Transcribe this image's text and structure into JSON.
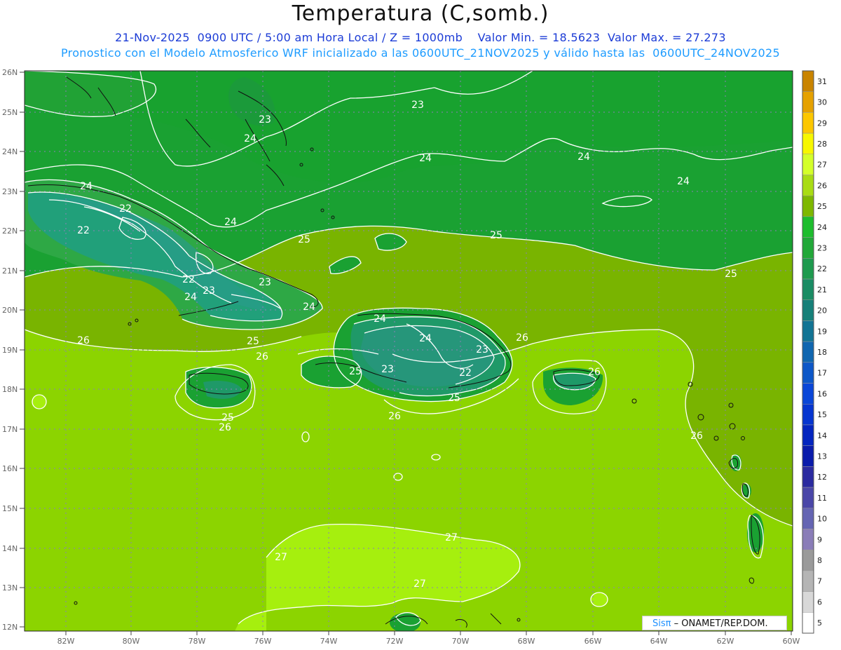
{
  "header": {
    "title": "Temperatura (C,somb.)",
    "line1": "21-Nov-2025  0900 UTC / 5:00 am Hora Local / Z = 1000mb    Valor Min. = 18.5623  Valor Max. = 27.273",
    "line2": "Pronostico con el Modelo Atmosferico WRF inicializado a las 0600UTC_21NOV2025 y válido hasta las  0600UTC_24NOV2025"
  },
  "map": {
    "lat_labels": [
      "26N",
      "25N",
      "24N",
      "23N",
      "22N",
      "21N",
      "20N",
      "19N",
      "18N",
      "17N",
      "16N",
      "15N",
      "14N",
      "13N",
      "12N"
    ],
    "lon_labels": [
      "82W",
      "80W",
      "78W",
      "76W",
      "74W",
      "72W",
      "70W",
      "68W",
      "66W",
      "64W",
      "62W",
      "60W"
    ],
    "contour_labels": [
      {
        "text": "23"
      },
      {
        "text": "23"
      },
      {
        "text": "24"
      },
      {
        "text": "24"
      },
      {
        "text": "24"
      },
      {
        "text": "24"
      },
      {
        "text": "24"
      },
      {
        "text": "22"
      },
      {
        "text": "22"
      },
      {
        "text": "24"
      },
      {
        "text": "25"
      },
      {
        "text": "25"
      },
      {
        "text": "25"
      },
      {
        "text": "22"
      },
      {
        "text": "23"
      },
      {
        "text": "23"
      },
      {
        "text": "24"
      },
      {
        "text": "24"
      },
      {
        "text": "26"
      },
      {
        "text": "25"
      },
      {
        "text": "26"
      },
      {
        "text": "24"
      },
      {
        "text": "24"
      },
      {
        "text": "23"
      },
      {
        "text": "26"
      },
      {
        "text": "25"
      },
      {
        "text": "23"
      },
      {
        "text": "22"
      },
      {
        "text": "25"
      },
      {
        "text": "26"
      },
      {
        "text": "26"
      },
      {
        "text": "25"
      },
      {
        "text": "26"
      },
      {
        "text": "26"
      },
      {
        "text": "27"
      },
      {
        "text": "27"
      },
      {
        "text": "27"
      }
    ]
  },
  "legend": {
    "levels": [
      "31",
      "30",
      "29",
      "28",
      "27",
      "26",
      "25",
      "24",
      "23",
      "22",
      "21",
      "20",
      "19",
      "18",
      "17",
      "16",
      "15",
      "14",
      "13",
      "12",
      "11",
      "10",
      "9",
      "8",
      "7",
      "6",
      "5"
    ],
    "colors": [
      "#c98400",
      "#e5a100",
      "#fcc700",
      "#f7f700",
      "#d4ff2a",
      "#a9dc14",
      "#7eb800",
      "#1dbd2d",
      "#21a838",
      "#1e9a4e",
      "#1a8c64",
      "#168079",
      "#127494",
      "#1066b0",
      "#0d57c8",
      "#0a46d8",
      "#0635d0",
      "#0425bf",
      "#0a1bab",
      "#2b2aa0",
      "#4a46a8",
      "#6565b3",
      "#8a7db8",
      "#9a9a9a",
      "#b5b5b5",
      "#d8d8d8",
      "#ffffff"
    ]
  },
  "credit": {
    "brand": "Sisπ",
    "text": " – ONAMET/REP.DOM."
  },
  "colors": {
    "green_dark": "#1aa132",
    "green_mid": "#33ac2e",
    "teal": "#2c9a65",
    "olive": "#79b400",
    "lime": "#8cd400",
    "yellow_green": "#a6ef0e"
  }
}
